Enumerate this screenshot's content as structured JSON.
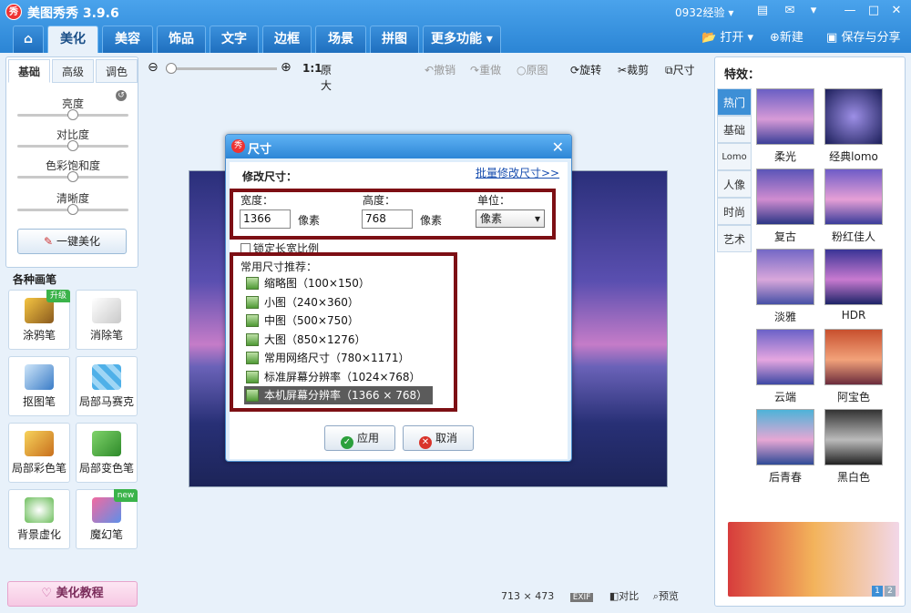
{
  "window": {
    "title": "美图秀秀 3.9.6",
    "logo": "秀",
    "user": "0932经验 ▾"
  },
  "tabs": [
    {
      "label": "美化",
      "active": true
    },
    {
      "label": "美容"
    },
    {
      "label": "饰品"
    },
    {
      "label": "文字"
    },
    {
      "label": "边框"
    },
    {
      "label": "场景"
    },
    {
      "label": "拼图"
    },
    {
      "label": "更多功能 ▾"
    }
  ],
  "top_actions": {
    "open": "打开",
    "new": "新建",
    "save": "保存与分享"
  },
  "left_panel": {
    "tabs": [
      "基础",
      "高级",
      "调色"
    ],
    "sliders": [
      {
        "label": "亮度",
        "value": 0.5
      },
      {
        "label": "对比度",
        "value": 0.5
      },
      {
        "label": "色彩饱和度",
        "value": 0.5
      },
      {
        "label": "清晰度",
        "value": 0.5
      }
    ],
    "one_key": "一键美化",
    "brush_title": "各种画笔",
    "brushes": [
      {
        "label": "涂鸦笔",
        "badge": "升级"
      },
      {
        "label": "消除笔"
      },
      {
        "label": "抠图笔"
      },
      {
        "label": "局部马赛克"
      },
      {
        "label": "局部彩色笔"
      },
      {
        "label": "局部变色笔"
      },
      {
        "label": "背景虚化"
      },
      {
        "label": "魔幻笔",
        "badge": "new"
      }
    ],
    "tutorial": "美化教程"
  },
  "zoom": {
    "ratio": "1:1",
    "original": "原大"
  },
  "edit_tools": {
    "undo": "撤销",
    "redo": "重做",
    "orig": "原图",
    "rotate": "旋转",
    "crop": "裁剪",
    "size": "尺寸"
  },
  "status": {
    "dims": "713 × 473",
    "exif": "EXIF",
    "compare": "对比",
    "preview": "预览"
  },
  "right_panel": {
    "title": "特效：",
    "tabs": [
      "热门",
      "基础",
      "Lomo",
      "人像",
      "时尚",
      "艺术"
    ],
    "effects": [
      "柔光",
      "经典lomo",
      "复古",
      "粉红佳人",
      "淡雅",
      "HDR",
      "云端",
      "阿宝色",
      "后青春",
      "黑白色"
    ],
    "pages": [
      "1",
      "2"
    ]
  },
  "dialog": {
    "title": "尺寸",
    "logo": "秀",
    "heading": "修改尺寸：",
    "batch": "批量修改尺寸>>",
    "width_label": "宽度：",
    "width_value": "1366",
    "width_unit": "像素",
    "height_label": "高度：",
    "height_value": "768",
    "height_unit": "像素",
    "unit_label": "单位：",
    "unit_value": "像素",
    "lock_ratio": "锁定长宽比例",
    "presets_title": "常用尺寸推荐：",
    "presets": [
      "缩略图（100×150）",
      "小图（240×360）",
      "中图（500×750）",
      "大图（850×1276）",
      "常用网络尺寸（780×1171）",
      "标准屏幕分辨率（1024×768）",
      "本机屏幕分辨率（1366 × 768）"
    ],
    "apply": "应用",
    "cancel": "取消"
  }
}
